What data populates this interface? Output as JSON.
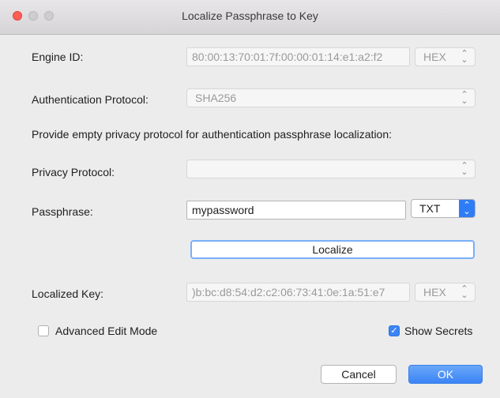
{
  "window": {
    "title": "Localize Passphrase to Key"
  },
  "engine": {
    "label": "Engine ID:",
    "value": "80:00:13:70:01:7f:00:00:01:14:e1:a2:f2",
    "format": "HEX"
  },
  "auth": {
    "label": "Authentication Protocol:",
    "value": "SHA256"
  },
  "note": "Provide empty privacy protocol for authentication passphrase localization:",
  "privacy": {
    "label": "Privacy Protocol:",
    "value": ""
  },
  "passphrase": {
    "label": "Passphrase:",
    "value": "mypassword",
    "format": "TXT"
  },
  "localize_button": "Localize",
  "localized": {
    "label": "Localized Key:",
    "value": ")b:bc:d8:54:d2:c2:06:73:41:0e:1a:51:e7",
    "format": "HEX"
  },
  "advanced": {
    "label": "Advanced Edit Mode",
    "checked": false
  },
  "secrets": {
    "label": "Show Secrets",
    "checked": true
  },
  "buttons": {
    "cancel": "Cancel",
    "ok": "OK"
  },
  "icons": {
    "chevron": "chevron-updown-icon",
    "check": "checkmark-icon"
  },
  "colors": {
    "accent": "#3b84f5",
    "close": "#fd5f57"
  }
}
